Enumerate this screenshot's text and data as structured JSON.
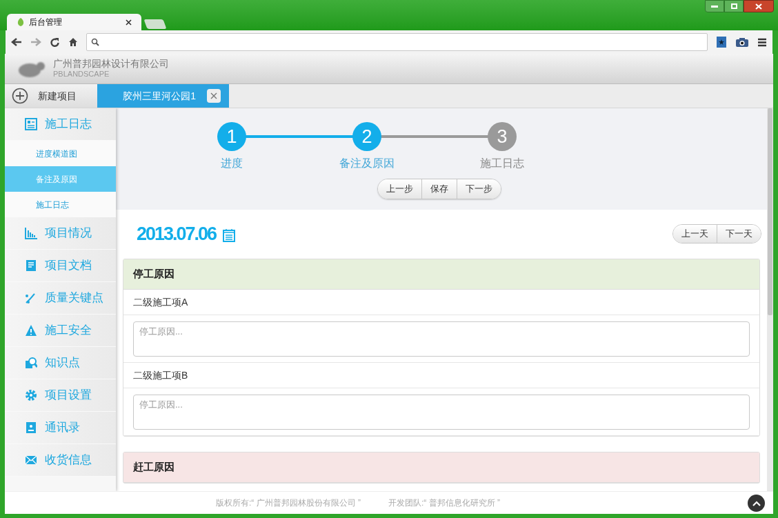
{
  "browser": {
    "tabs": [
      {
        "title": "后台管理",
        "selected": true
      }
    ]
  },
  "header": {
    "company": "广州普邦园林设计有限公司",
    "company_en": "PBLANDSCAPE"
  },
  "project_tabs": {
    "new_label": "新建项目",
    "tabs": [
      {
        "label": "胶州三里河公园1",
        "selected": true
      }
    ]
  },
  "sidebar": {
    "items": [
      {
        "label": "施工日志",
        "children": [
          {
            "label": "进度横道图",
            "selected": false
          },
          {
            "label": "备注及原因",
            "selected": true
          },
          {
            "label": "施工日志",
            "selected": false
          }
        ]
      },
      {
        "label": "项目情况"
      },
      {
        "label": "项目文档"
      },
      {
        "label": "质量关键点"
      },
      {
        "label": "施工安全"
      },
      {
        "label": "知识点"
      },
      {
        "label": "项目设置"
      },
      {
        "label": "通讯录"
      },
      {
        "label": "收货信息"
      }
    ]
  },
  "steps": [
    {
      "number": "1",
      "label": "进度",
      "active": true
    },
    {
      "number": "2",
      "label": "备注及原因",
      "active": true
    },
    {
      "number": "3",
      "label": "施工日志",
      "active": false
    }
  ],
  "step_buttons": [
    "上一步",
    "保存",
    "下一步"
  ],
  "date": "2013.07.06",
  "day_buttons": [
    "上一天",
    "下一天"
  ],
  "sections": [
    {
      "title": "停工原因",
      "kind": "stop",
      "items": [
        {
          "label": "二级施工项A",
          "placeholder": "停工原因..."
        },
        {
          "label": "二级施工项B",
          "placeholder": "停工原因..."
        }
      ]
    },
    {
      "title": "赶工原因",
      "kind": "rush"
    }
  ],
  "footer": {
    "copyright": "版权所有:“ 广州普邦园林股份有限公司 ”",
    "team": "开发团队:“ 普邦信息化研究所 ”"
  }
}
